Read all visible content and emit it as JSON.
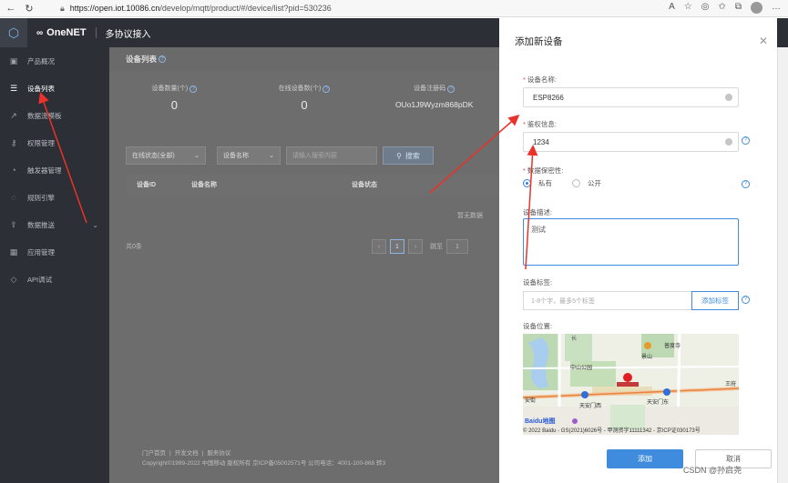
{
  "browser": {
    "url_host": "https://open.iot.10086.cn",
    "url_path": "/develop/mqtt/product/#/device/list?pid=530236"
  },
  "header": {
    "brand": "OneNET",
    "subtitle": "多协议接入"
  },
  "sidebar": {
    "items": [
      {
        "label": "产品概况",
        "icon": "box-icon"
      },
      {
        "label": "设备列表",
        "icon": "list-icon",
        "active": true
      },
      {
        "label": "数据流模板",
        "icon": "chart-icon"
      },
      {
        "label": "权限管理",
        "icon": "key-icon"
      },
      {
        "label": "触发器管理",
        "icon": "bell-icon"
      },
      {
        "label": "规则引擎",
        "icon": "rule-icon"
      },
      {
        "label": "数据推送",
        "icon": "push-icon"
      },
      {
        "label": "应用管理",
        "icon": "grid-icon"
      },
      {
        "label": "API调试",
        "icon": "api-icon"
      }
    ]
  },
  "main": {
    "title": "设备列表",
    "stats": [
      {
        "label": "设备数量(个)",
        "value": "0"
      },
      {
        "label": "在线设备数(个)",
        "value": "0"
      },
      {
        "label": "设备注册码",
        "value": "OUo1J9Wyzm868pDK"
      }
    ],
    "filter_status": "在线状态(全部)",
    "filter_field": "设备名称",
    "search_placeholder": "请输入搜索内容",
    "search_button": "搜索",
    "columns": [
      "设备ID",
      "设备名称",
      "设备状态"
    ],
    "empty_text": "暂无数据",
    "total": "共0条",
    "page": "1",
    "jump_label": "跳至",
    "jump_value": "1"
  },
  "footer": {
    "links": [
      "门户首页",
      "|",
      "开发文档",
      "|",
      "服务协议"
    ],
    "copyright": "Copyright©1999-2022 中国移动 版权所有 京ICP备05002571号 公司电话：4001-100-868 转3"
  },
  "drawer": {
    "title": "添加新设备",
    "name_label": "设备名称:",
    "name_value": "ESP8266",
    "auth_label": "鉴权信息:",
    "auth_value": "1234",
    "privacy_label": "数据保密性:",
    "private_option": "私有",
    "public_option": "公开",
    "desc_label": "设备描述:",
    "desc_value": "测试",
    "tag_label": "设备标签:",
    "tag_placeholder": "1-8个字，最多5个标签",
    "tag_button": "添加标签",
    "location_label": "设备位置:",
    "map_caption": "© 2022 Baidu - GS(2021)6026号 - 甲测资字11111342 - 京ICP证030173号",
    "map_logo": "Baidu地图",
    "map_labels": [
      "长",
      "中山公园",
      "景山",
      "普度寺",
      "天安门西",
      "天安门东",
      "安街",
      "王府"
    ],
    "submit": "添加",
    "cancel": "取消"
  },
  "watermark": "CSDN @孙启尧",
  "colors": {
    "accent": "#3f8cde",
    "sidebar": "#2c2f36",
    "required": "#f04134",
    "arrow": "#e8322a"
  }
}
